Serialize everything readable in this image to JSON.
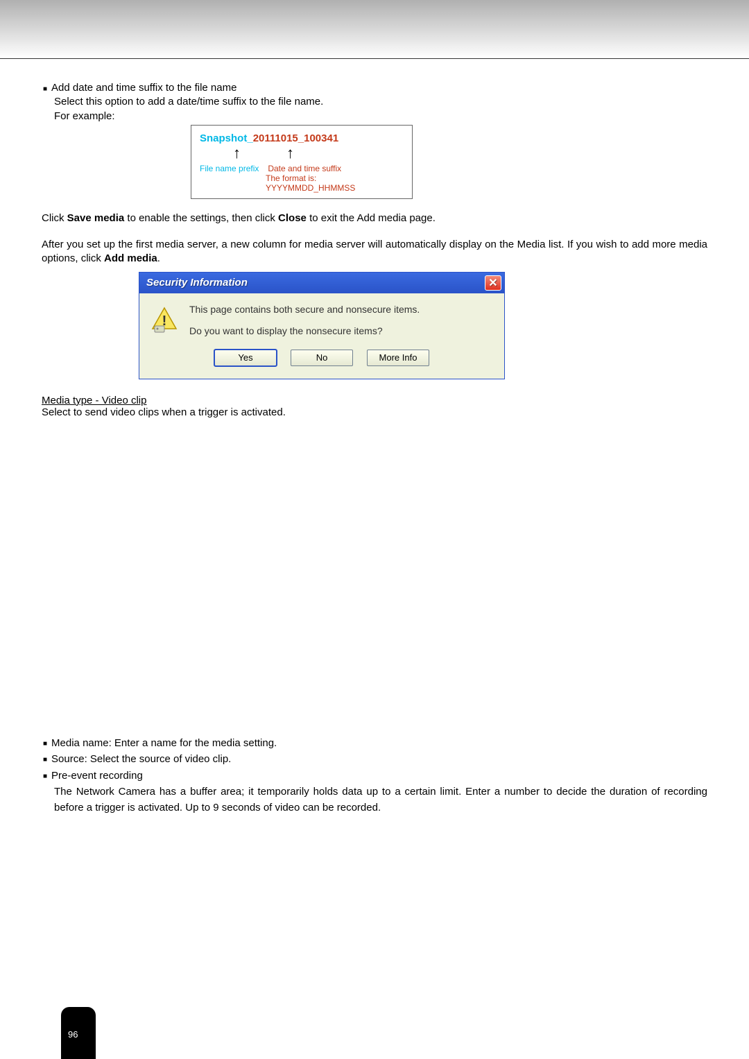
{
  "section1": {
    "bullet_title": "Add date and time suffix to the file name",
    "sub1": "Select this option to add a date/time suffix to the file name.",
    "sub2": "For example:"
  },
  "example": {
    "prefix": "Snapshot_",
    "suffix": "20111015_100341",
    "label_prefix": "File name prefix",
    "label_suffix": "Date and time suffix",
    "format": "The format is: YYYYMMDD_HHMMSS"
  },
  "para1": {
    "t1": "Click ",
    "b1": "Save media",
    "t2": " to enable the settings, then click ",
    "b2": "Close",
    "t3": " to exit the Add media page."
  },
  "para2": {
    "t1": "After you set up the first media server, a new column for media server will automatically display on the Media list. If you wish to add more media options, click ",
    "b1": "Add media",
    "t2": "."
  },
  "dialog": {
    "title": "Security Information",
    "line1": "This page contains both secure and nonsecure items.",
    "line2": "Do you want to display the nonsecure items?",
    "btn_yes": "Yes",
    "btn_no": "No",
    "btn_more": "More Info"
  },
  "section2": {
    "heading": "Media type - Video clip",
    "text": "Select to send video clips when a trigger is activated."
  },
  "section3": {
    "r1": "Media name: Enter a name for the media setting.",
    "r2": "Source: Select the source of video clip.",
    "r3": "Pre-event recording",
    "r3_sub": "The Network Camera has a buffer area; it temporarily holds data up to a certain limit. Enter a number to decide the duration of recording before a trigger is activated. Up to 9 seconds of video can be recorded."
  },
  "page_number": "96"
}
